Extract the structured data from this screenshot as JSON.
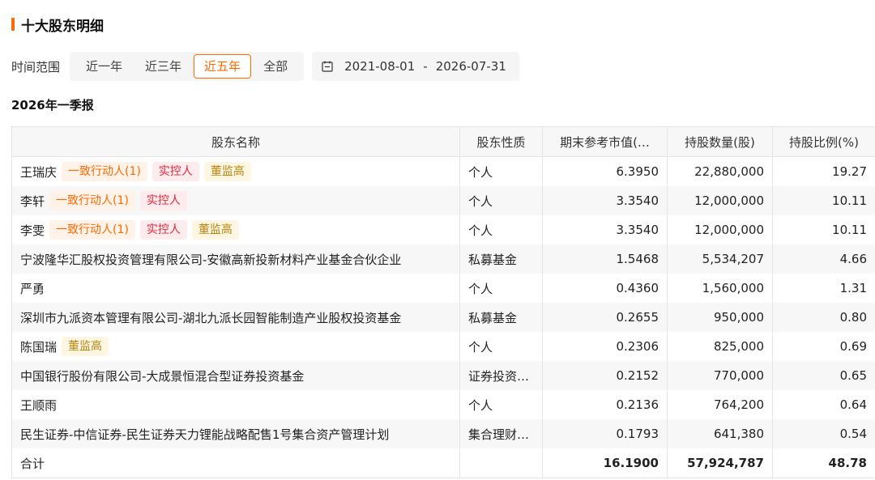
{
  "section_title": "十大股东明细",
  "filter": {
    "label": "时间范围",
    "options": [
      "近一年",
      "近三年",
      "近五年",
      "全部"
    ],
    "selected": "近五年",
    "date_start": "2021-08-01",
    "date_separator": "-",
    "date_end": "2026-07-31"
  },
  "report_title": "2026年一季报",
  "table": {
    "headers": [
      "股东名称",
      "股东性质",
      "期末参考市值(…",
      "持股数量(股)",
      "持股比例(%)"
    ],
    "rows": [
      {
        "name": "王瑞庆",
        "tags": [
          {
            "text": "一致行动人(1)",
            "color": "orange"
          },
          {
            "text": "实控人",
            "color": "red"
          },
          {
            "text": "董监高",
            "color": "gold"
          }
        ],
        "nature": "个人",
        "value": "6.3950",
        "shares": "22,880,000",
        "ratio": "19.27"
      },
      {
        "name": "李轩",
        "tags": [
          {
            "text": "一致行动人(1)",
            "color": "orange"
          },
          {
            "text": "实控人",
            "color": "red"
          }
        ],
        "nature": "个人",
        "value": "3.3540",
        "shares": "12,000,000",
        "ratio": "10.11"
      },
      {
        "name": "李雯",
        "tags": [
          {
            "text": "一致行动人(1)",
            "color": "orange"
          },
          {
            "text": "实控人",
            "color": "red"
          },
          {
            "text": "董监高",
            "color": "gold"
          }
        ],
        "nature": "个人",
        "value": "3.3540",
        "shares": "12,000,000",
        "ratio": "10.11"
      },
      {
        "name": "宁波隆华汇股权投资管理有限公司-安徽高新投新材料产业基金合伙企业",
        "tags": [],
        "nature": "私募基金",
        "value": "1.5468",
        "shares": "5,534,207",
        "ratio": "4.66"
      },
      {
        "name": "严勇",
        "tags": [],
        "nature": "个人",
        "value": "0.4360",
        "shares": "1,560,000",
        "ratio": "1.31"
      },
      {
        "name": "深圳市九派资本管理有限公司-湖北九派长园智能制造产业股权投资基金",
        "tags": [],
        "nature": "私募基金",
        "value": "0.2655",
        "shares": "950,000",
        "ratio": "0.80"
      },
      {
        "name": "陈国瑞",
        "tags": [
          {
            "text": "董监高",
            "color": "gold"
          }
        ],
        "nature": "个人",
        "value": "0.2306",
        "shares": "825,000",
        "ratio": "0.69"
      },
      {
        "name": "中国银行股份有限公司-大成景恒混合型证券投资基金",
        "tags": [],
        "nature": "证券投资基金",
        "value": "0.2152",
        "shares": "770,000",
        "ratio": "0.65"
      },
      {
        "name": "王顺雨",
        "tags": [],
        "nature": "个人",
        "value": "0.2136",
        "shares": "764,200",
        "ratio": "0.64"
      },
      {
        "name": "民生证券-中信证券-民生证券天力锂能战略配售1号集合资产管理计划",
        "tags": [],
        "nature": "集合理财计划",
        "value": "0.1793",
        "shares": "641,380",
        "ratio": "0.54"
      }
    ],
    "total": {
      "label": "合计",
      "nature": "",
      "value": "16.1900",
      "shares": "57,924,787",
      "ratio": "48.78"
    }
  },
  "colors": {
    "accent": "#ff6a00",
    "tag_orange": "#ff6a00",
    "tag_red": "#e02a3a",
    "tag_gold": "#b8860b"
  },
  "icons": {
    "date": "calendar-icon"
  }
}
